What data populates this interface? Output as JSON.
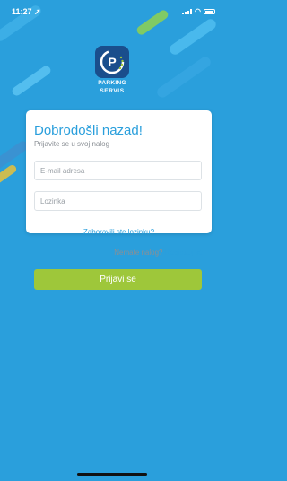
{
  "status_bar": {
    "time": "11:27",
    "location_icon": "location-arrow-icon",
    "signal_icon": "signal-icon",
    "wifi_icon": "wifi-icon",
    "battery_icon": "battery-icon"
  },
  "logo": {
    "line1": "PARKING",
    "line2": "SERVIS",
    "badge_color": "#1a4e8c"
  },
  "login": {
    "title": "Dobrodošli nazad!",
    "subtitle": "Prijavite se u svoj nalog",
    "email_placeholder": "E-mail adresa",
    "password_placeholder": "Lozinka",
    "forgot_password": "Zaboravili ste lozinku?",
    "no_account": "Nemate nalog?",
    "register_link": "Registruj se",
    "submit": "Prijavi se"
  },
  "colors": {
    "background": "#2a9fdc",
    "accent": "#2a9fdc",
    "button": "#9ec73a"
  }
}
